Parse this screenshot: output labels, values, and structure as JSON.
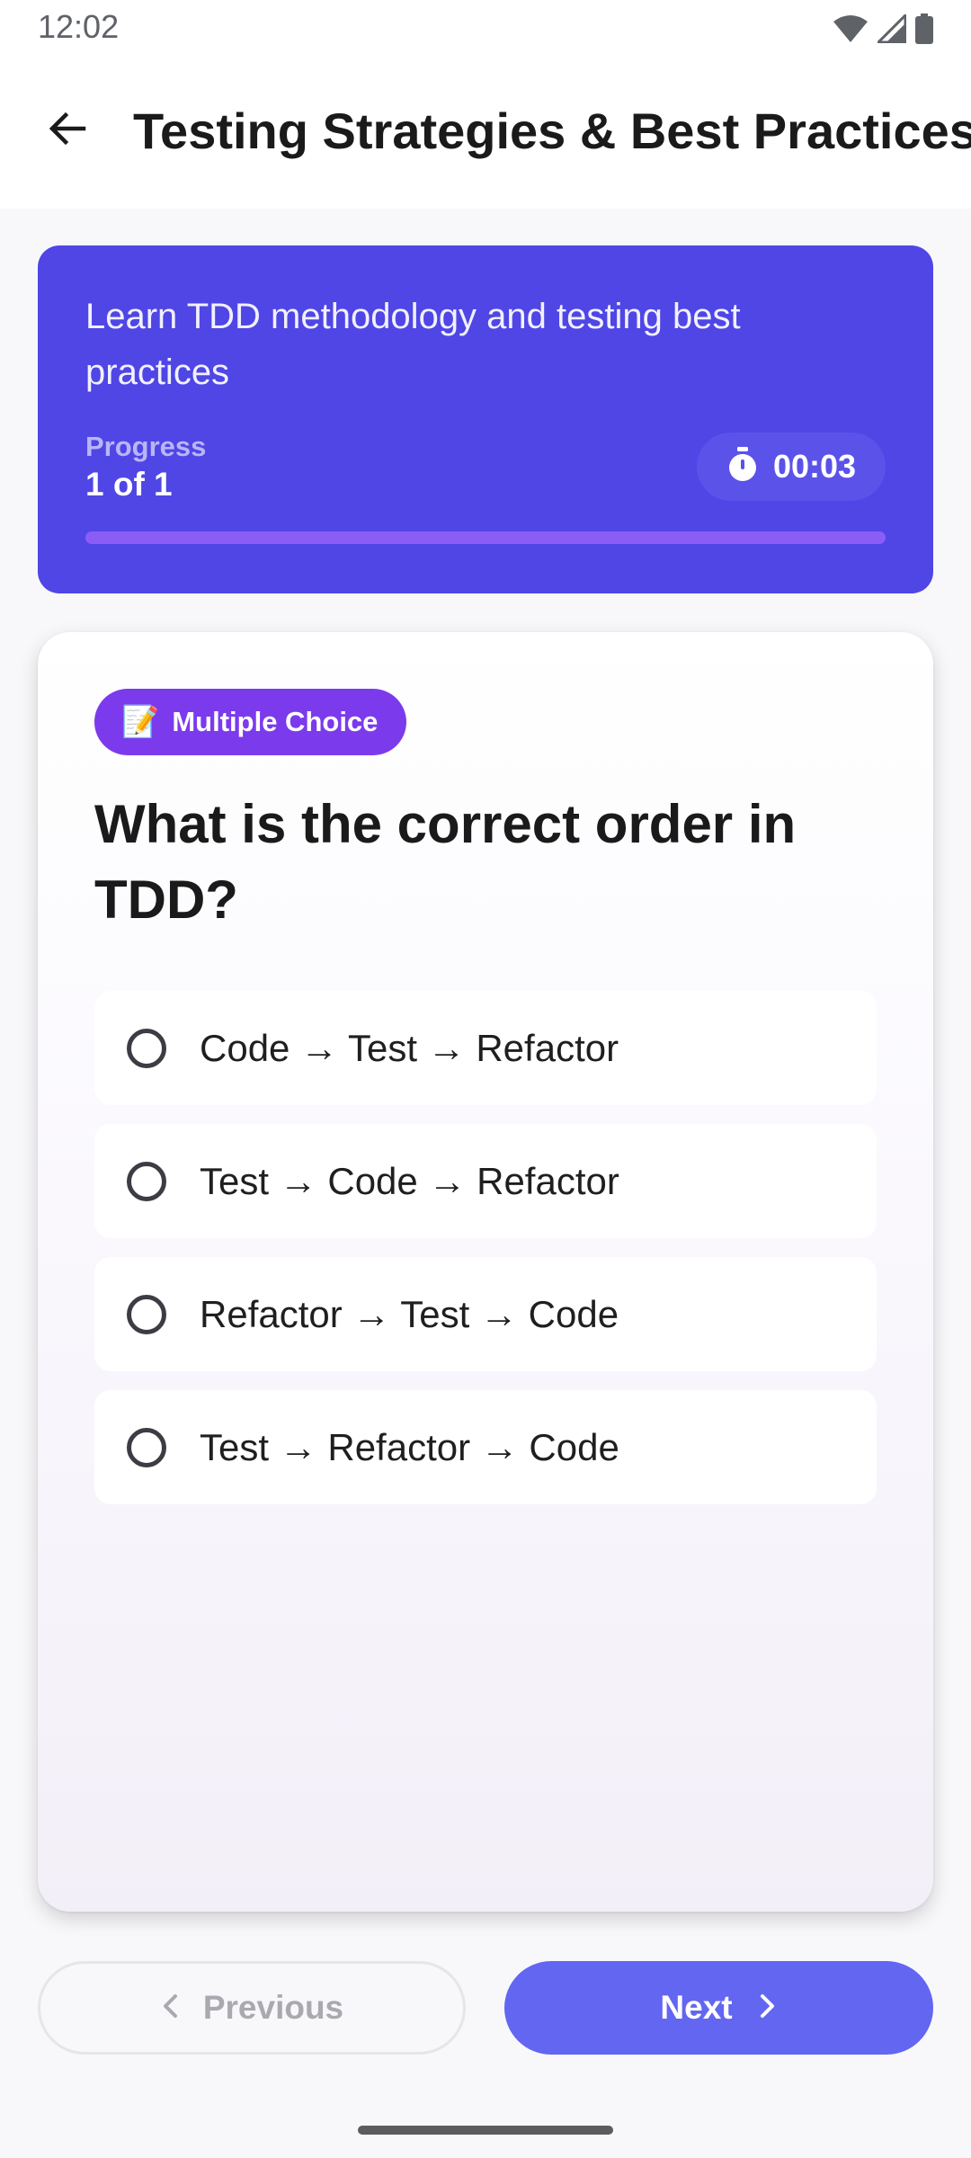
{
  "status_bar": {
    "time": "12:02",
    "icons": [
      "wifi-icon",
      "cellular-signal-icon",
      "battery-icon"
    ]
  },
  "header": {
    "back_icon": "arrow-left-icon",
    "title": "Testing Strategies & Best Practices"
  },
  "hero": {
    "description": "Learn TDD methodology and testing best practices",
    "progress_label": "Progress",
    "progress_value": "1 of 1",
    "progress_fraction": 1.0,
    "timer": {
      "icon": "stopwatch-icon",
      "value": "00:03"
    }
  },
  "question": {
    "type_badge": {
      "emoji": "📝",
      "label": "Multiple Choice"
    },
    "text": "What is the correct order in TDD?",
    "options": [
      {
        "label": "Code → Test → Refactor",
        "selected": false
      },
      {
        "label": "Test → Code → Refactor",
        "selected": false
      },
      {
        "label": "Refactor → Test → Code",
        "selected": false
      },
      {
        "label": "Test → Refactor → Code",
        "selected": false
      }
    ]
  },
  "navigation": {
    "previous_label": "Previous",
    "previous_enabled": false,
    "next_label": "Next"
  },
  "colors": {
    "hero_background": "#4F46E5",
    "badge_background": "#7C3AED",
    "next_button": "#6366F1",
    "progress_fill": "#8B5CF6"
  }
}
